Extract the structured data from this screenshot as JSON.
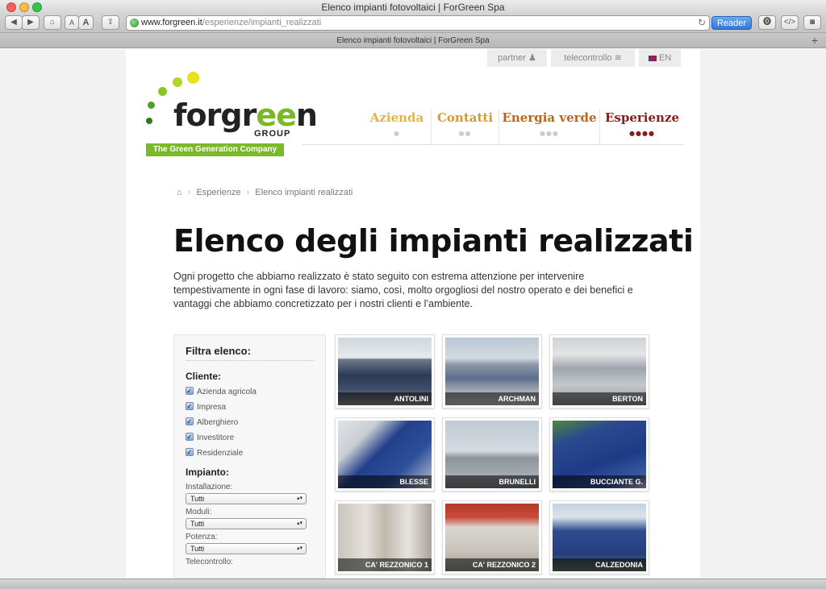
{
  "window": {
    "title": "Elenco impianti fotovoltaici | ForGreen Spa"
  },
  "toolbar": {
    "url_domain": "www.forgreen.it",
    "url_path": "/esperienze/impianti_realizzati",
    "reader": "Reader",
    "font_small": "A",
    "font_large": "A"
  },
  "tab": {
    "title": "Elenco impianti fotovoltaici | ForGreen Spa"
  },
  "util_nav": {
    "partner": "partner",
    "telecontrollo": "telecontrollo",
    "lang": "EN"
  },
  "logo": {
    "wordmark_a": "forgr",
    "wordmark_b": "ee",
    "wordmark_c": "n",
    "group": "GROUP",
    "tagline": "The Green Generation Company"
  },
  "main_nav": [
    {
      "label": "Azienda",
      "color": "#e6b43a",
      "dots": "●"
    },
    {
      "label": "Contatti",
      "color": "#d89a2a",
      "dots": "●●"
    },
    {
      "label": "Energia verde",
      "color": "#b8661a",
      "dots": "●●●"
    },
    {
      "label": "Esperienze",
      "color": "#8b1a1a",
      "dots": "●●●●"
    }
  ],
  "breadcrumb": {
    "home_icon": "⌂",
    "level1": "Esperienze",
    "level2": "Elenco impianti realizzati"
  },
  "page": {
    "title": "Elenco degli impianti realizzati",
    "intro": "Ogni progetto che abbiamo realizzato è stato seguito con estrema attenzione per intervenire tempestivamente in ogni fase di lavoro: siamo, così, molto orgogliosi del nostro operato e dei benefici e vantaggi che abbiamo concretizzato per i nostri clienti e l’ambiente."
  },
  "filter": {
    "title": "Filtra elenco:",
    "cliente_label": "Cliente:",
    "cliente_options": [
      "Azienda agricola",
      "Impresa",
      "Alberghiero",
      "Investitore",
      "Residenziale"
    ],
    "impianto_label": "Impianto:",
    "installazione_label": "Installazione:",
    "installazione_value": "Tutti",
    "moduli_label": "Moduli:",
    "moduli_value": "Tutti",
    "potenza_label": "Potenza:",
    "potenza_value": "Tutti",
    "telecontrollo_label": "Telecontrollo:"
  },
  "projects": [
    "ANTOLINI",
    "ARCHMAN",
    "BERTON",
    "BI.ESSE",
    "BRUNELLI",
    "BUCCIANTE G.",
    "CA' REZZONICO 1",
    "CA' REZZONICO 2",
    "CALZEDONIA"
  ]
}
